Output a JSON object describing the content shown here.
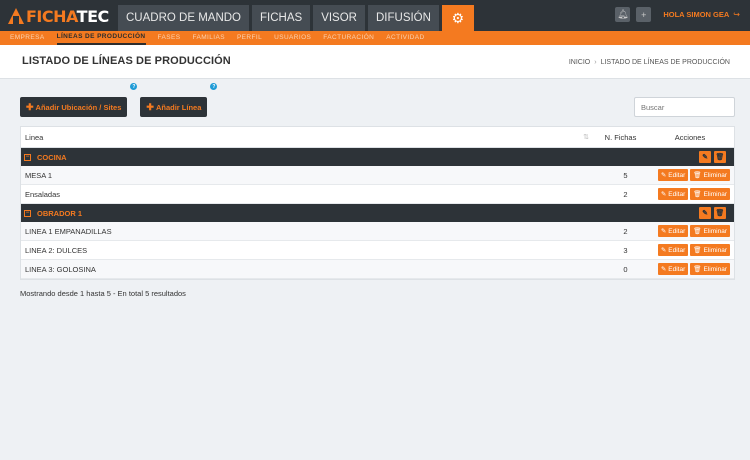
{
  "logo": {
    "part1": "FICHA",
    "part2": "TEC"
  },
  "main_nav": [
    {
      "label": "CUADRO DE MANDO"
    },
    {
      "label": "FICHAS"
    },
    {
      "label": "VISOR"
    },
    {
      "label": "DIFUSIÓN"
    }
  ],
  "settings_icon": "gear-icon",
  "top_right": {
    "bell_icon": "bell-icon",
    "plus_icon": "plus-icon",
    "greeting": "HOLA SIMON GEA",
    "logout_icon": "logout-icon"
  },
  "sub_nav": [
    {
      "label": "EMPRESA",
      "active": false
    },
    {
      "label": "LÍNEAS DE PRODUCCIÓN",
      "active": true
    },
    {
      "label": "FASES",
      "active": false
    },
    {
      "label": "FAMILIAS",
      "active": false
    },
    {
      "label": "PERFIL",
      "active": false
    },
    {
      "label": "USUARIOS",
      "active": false
    },
    {
      "label": "FACTURACIÓN",
      "active": false
    },
    {
      "label": "ACTIVIDAD",
      "active": false
    }
  ],
  "page": {
    "title": "LISTADO DE LÍNEAS DE PRODUCCIÓN",
    "breadcrumb": {
      "home": "INICIO",
      "sep": "›",
      "current": "LISTADO DE LÍNEAS DE PRODUCCIÓN"
    }
  },
  "buttons": {
    "add_location": "Añadir Ubicación / Sites",
    "add_line": "Añadir Línea",
    "help": "?"
  },
  "search": {
    "placeholder": "Buscar",
    "value": ""
  },
  "table": {
    "headers": {
      "linea": "Linea",
      "fichas": "N. Fichas",
      "acciones": "Acciones"
    },
    "edit_label": "Editar",
    "delete_label": "Eliminar",
    "groups": [
      {
        "name": "COCINA",
        "rows": [
          {
            "linea": "MESA 1",
            "fichas": "5"
          },
          {
            "linea": "Ensaladas",
            "fichas": "2"
          }
        ]
      },
      {
        "name": "OBRADOR 1",
        "rows": [
          {
            "linea": "LINEA 1 EMPANADILLAS",
            "fichas": "2"
          },
          {
            "linea": "LINEA 2: DULCES",
            "fichas": "3"
          },
          {
            "linea": "LINEA 3: GOLOSINA",
            "fichas": "0"
          }
        ]
      }
    ]
  },
  "summary": "Mostrando desde 1 hasta 5 - En total 5 resultados",
  "colors": {
    "accent": "#f47a20",
    "dark": "#2d3338",
    "background": "#eef1f4"
  }
}
